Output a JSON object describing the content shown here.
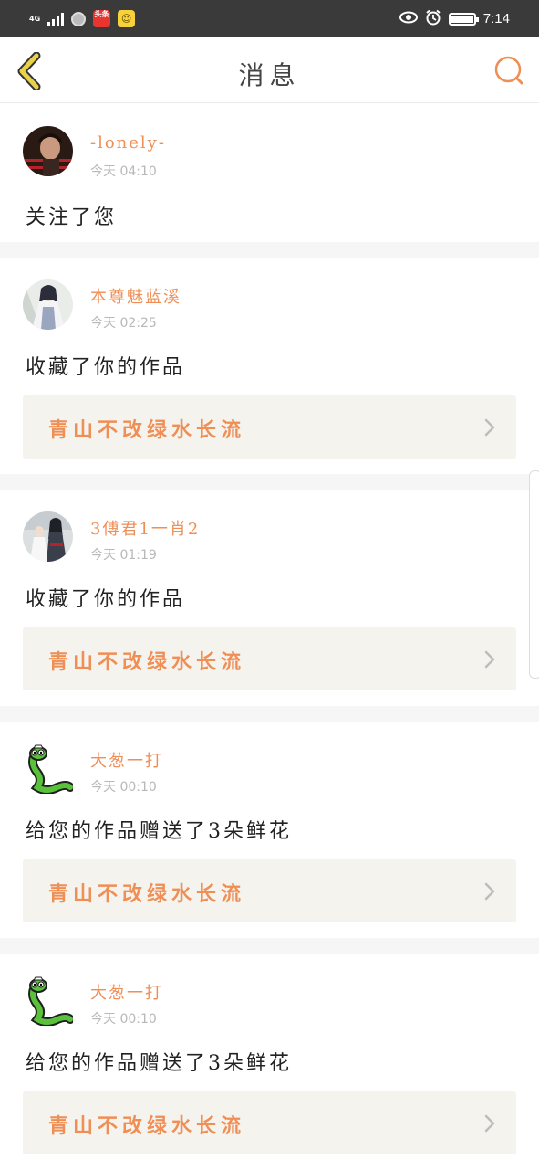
{
  "status_bar": {
    "network": "4G",
    "app1_label": "头条",
    "app2_label": "☺",
    "time": "7:14"
  },
  "header": {
    "title": "消息",
    "back_icon": "chevron-left-icon",
    "search_icon": "search-icon"
  },
  "colors": {
    "accent": "#ef8e55",
    "back_arrow": "#e9d24a",
    "card_bg": "#f4f3ed",
    "divider": "#f6f6f6",
    "statusbar": "#3a3a3a"
  },
  "notifications": [
    {
      "user": "-lonely-",
      "time": "今天 04:10",
      "message": "关注了您",
      "avatar": "avatar-dark-portrait"
    },
    {
      "user": "本尊魅蓝溪",
      "time": "今天 02:25",
      "message": "收藏了你的作品",
      "work_title": "青山不改绿水长流",
      "avatar": "avatar-anime-figure"
    },
    {
      "user": "3傅君1一肖2",
      "time": "今天 01:19",
      "message": "收藏了你的作品",
      "work_title": "青山不改绿水长流",
      "avatar": "avatar-anime-couple"
    },
    {
      "user": "大葱一打",
      "time": "今天 00:10",
      "message": "给您的作品赠送了3朵鲜花",
      "work_title": "青山不改绿水长流",
      "avatar": "avatar-green-snake"
    },
    {
      "user": "大葱一打",
      "time": "今天 00:10",
      "message": "给您的作品赠送了3朵鲜花",
      "work_title": "青山不改绿水长流",
      "avatar": "avatar-green-snake"
    }
  ]
}
